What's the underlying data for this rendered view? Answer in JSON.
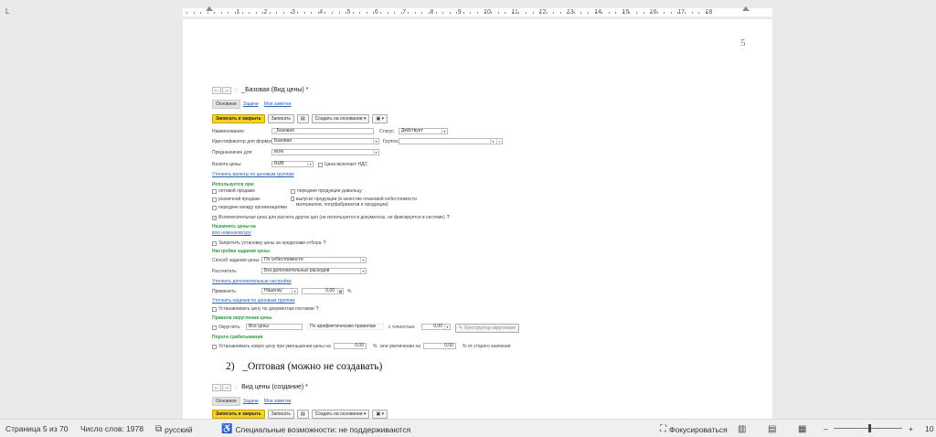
{
  "ruler": {
    "tab_glyph": "L",
    "numbers": [
      "1",
      "2",
      "3",
      "4",
      "5",
      "6",
      "7",
      "8",
      "9",
      "10",
      "11",
      "12",
      "13",
      "14",
      "15",
      "16",
      "17",
      "18"
    ]
  },
  "page": {
    "number": "5"
  },
  "form1": {
    "nav_back": "←",
    "nav_forward": "→",
    "star": "☆",
    "title": "_Базовая (Вид цены) *",
    "tabs": [
      "Основное",
      "Задачи",
      "Мои заметки"
    ],
    "save_close": "Записать и закрыть",
    "save": "Записать",
    "doc_icon": "▤",
    "create_based": "Создать на основании ▾",
    "more_icon": "▣ ▾",
    "name_label": "Наименование:",
    "name_value": "_Базовая",
    "status_label": "Статус:",
    "status_value": "Действует",
    "id_label": "Идентификатор для формул:",
    "id_value": "Базовая",
    "group_label": "Группа:",
    "purpose_label": "Предназначен для:",
    "purpose_value": "всех",
    "currency_label": "Валюта цены:",
    "currency_value": "RUB",
    "vat_label": "Цена включает НДС",
    "currency_link": "Уточнить валюты по ценовым группам",
    "used_for_section": "Используется при:",
    "cb_wholesale": "оптовой продаже",
    "cb_retail": "розничной продаже",
    "cb_transfer_orgs": "передаче между организациями",
    "cb_transfer_consignor": "передаче продукции давальцу",
    "cb_output": "выпуске продукции (в качестве плановой себестоимости материалов, полуфабрикатов и продукции)",
    "cb_auxiliary": "Вспомогательная цена для расчета других цен (не используется в документах, не фиксируется в системе)",
    "assign_section": "Назначить цены на",
    "assign_link": "всю номенклатуру",
    "forbid_label": "Запретить установку цены за пределами отбора",
    "settings_section": "Настройки задания цены:",
    "method_label": "Способ задания цены:",
    "method_value": "По себестоимости",
    "calc_label": "Рассчитать:",
    "calc_value": "Без дополнительных расходов",
    "extra_settings_link": "Уточнить дополнительные настройки",
    "apply_label": "Применить:",
    "apply_value": "Наценку",
    "apply_amount": "0,00",
    "percent": "%",
    "markup_link": "Уточнить наценки по ценовым группам",
    "docs_label": "Устанавливать цену по документам поставки",
    "rounding_section": "Правила округления цены",
    "round_label": "Округлять",
    "all_prices": "Все цены",
    "arith_rules": "По арифметическим правилам",
    "precision_label": "с точностью:",
    "precision_value": "0,00",
    "constructor": "Конструктор округления",
    "thresholds_section": "Пороги срабатывания",
    "threshold_label": "Устанавливать новую цену при уменьшении цены на",
    "decrease_value": "0,00",
    "or_increase": "или увеличении на",
    "increase_value": "0,00",
    "of_old": "% от старого значения"
  },
  "heading2": "2)   _Оптовая (можно не создавать)",
  "form2": {
    "title": "Вид цены (создание) *",
    "tabs": [
      "Основное",
      "Задачи",
      "Мои заметки"
    ],
    "save_close": "Записать и закрыть",
    "save": "Записать",
    "create_based": "Создать на основании ▾"
  },
  "statusbar": {
    "page": "Страница 5 из 70",
    "words": "Число слов: 1978",
    "language": "русский",
    "accessibility": "Специальные возможности: не поддерживаются",
    "focus": "Фокусироваться",
    "zoom_minus": "–",
    "zoom_plus": "+",
    "zoom_value": "10"
  }
}
